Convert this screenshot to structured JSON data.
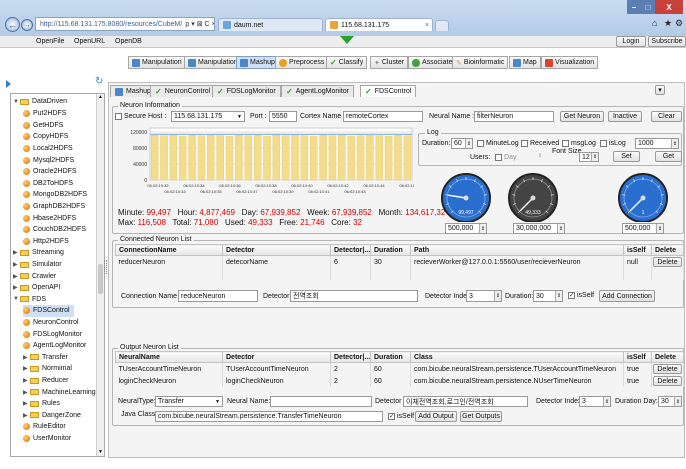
{
  "browser": {
    "address": "http://115.68.131.175:8080/resources/CubeM/",
    "address_controls": "ρ ▾ ⊠ C ×",
    "tabs": [
      {
        "label": "daum.net"
      },
      {
        "label": "115.68.131.175"
      }
    ],
    "window_buttons": [
      "–",
      "□",
      "X"
    ],
    "toolbar_icons": [
      "home-icon",
      "star-icon",
      "gear-icon"
    ]
  },
  "menu": {
    "items": [
      "OpenFile",
      "OpenURL",
      "OpenDB"
    ],
    "login": "Login",
    "subscribe": "Subscribe"
  },
  "modules": [
    {
      "label": "Manipulation",
      "color": "#4a86c8"
    },
    {
      "label": "Manipulation",
      "color": "#4a86c8"
    },
    {
      "label": "Mashup",
      "color": "#4a86c8"
    },
    {
      "label": "Preprocess",
      "color": "#e8a020"
    },
    {
      "label": "Classify",
      "color": "#3fa23f"
    },
    {
      "label": "Cluster",
      "color": "#d2d2d2"
    },
    {
      "label": "Associate",
      "color": "#3fa23f"
    },
    {
      "label": "Bioinformatic",
      "color": "#c8a04a"
    },
    {
      "label": "Map",
      "color": "#4a86c8"
    },
    {
      "label": "Visualization",
      "color": "#d4462f"
    }
  ],
  "tree": {
    "root": "DataDriven",
    "items": [
      {
        "label": "Put2HDFS",
        "kind": "leaf",
        "indent": 1
      },
      {
        "label": "GetHDFS",
        "kind": "leaf",
        "indent": 1
      },
      {
        "label": "CopyHDFS",
        "kind": "leaf",
        "indent": 1
      },
      {
        "label": "Local2HDFS",
        "kind": "leaf",
        "indent": 1
      },
      {
        "label": "Mysql2HDFS",
        "kind": "leaf",
        "indent": 1
      },
      {
        "label": "Oracle2HDFS",
        "kind": "leaf",
        "indent": 1
      },
      {
        "label": "DB2ToHDFS",
        "kind": "leaf",
        "indent": 1
      },
      {
        "label": "MongoDB2HDFS",
        "kind": "leaf",
        "indent": 1
      },
      {
        "label": "GraphDB2HDFS",
        "kind": "leaf",
        "indent": 1
      },
      {
        "label": "Hbase2HDFS",
        "kind": "leaf",
        "indent": 1
      },
      {
        "label": "CouchDB2HDFS",
        "kind": "leaf",
        "indent": 1
      },
      {
        "label": "Http2HDFS",
        "kind": "leaf",
        "indent": 1
      },
      {
        "label": "Streaming",
        "kind": "folder",
        "indent": 0
      },
      {
        "label": "Simulator",
        "kind": "folder",
        "indent": 0
      },
      {
        "label": "Crawler",
        "kind": "folder",
        "indent": 0
      },
      {
        "label": "OpenAPI",
        "kind": "folder",
        "indent": 0
      },
      {
        "label": "FDS",
        "kind": "folder-open",
        "indent": 0
      },
      {
        "label": "FDSControl",
        "kind": "leaf-selected",
        "indent": 1
      },
      {
        "label": "NeuronControl",
        "kind": "leaf",
        "indent": 1
      },
      {
        "label": "FDSLogMonitor",
        "kind": "leaf",
        "indent": 1
      },
      {
        "label": "AgentLogMonitor",
        "kind": "leaf",
        "indent": 1
      },
      {
        "label": "Transfer",
        "kind": "folder",
        "indent": 1
      },
      {
        "label": "Normimal",
        "kind": "folder",
        "indent": 1
      },
      {
        "label": "Reducer",
        "kind": "folder",
        "indent": 1
      },
      {
        "label": "MachineLearning",
        "kind": "folder",
        "indent": 1
      },
      {
        "label": "Rules",
        "kind": "folder",
        "indent": 1
      },
      {
        "label": "DangerZone",
        "kind": "folder",
        "indent": 1
      },
      {
        "label": "RuleEditor",
        "kind": "leaf",
        "indent": 1
      },
      {
        "label": "UserMonitor",
        "kind": "leaf",
        "indent": 1
      }
    ]
  },
  "panel_tabs": [
    {
      "label": "Mashup",
      "selected": false
    },
    {
      "label": "NeuronControl",
      "selected": false
    },
    {
      "label": "FDSLogMonitor",
      "selected": false
    },
    {
      "label": "AgentLogMonitor",
      "selected": false
    },
    {
      "label": "FDSControl",
      "selected": true
    }
  ],
  "neuron_info": {
    "legend": "Neuron Information",
    "secure_label": "Secure",
    "host_label": "Host :",
    "host": "115.68.131.175",
    "port_label": "Port :",
    "port": "5550",
    "cortex_label": "Cortex Name :",
    "cortex": "remoteCortex",
    "neural_label": "Neural Name :",
    "neural": "filterNeuron",
    "get_neuron": "Get Neuron",
    "inactive": "Inactive",
    "clear": "Clear"
  },
  "chart_data": {
    "type": "bar",
    "title": "",
    "y_ticks": [
      "120000",
      "80000",
      "40000",
      "0"
    ],
    "ylim": [
      0,
      130000
    ],
    "x_ticks_top": [
      "06:02:10:32",
      "06:02:10:34",
      "06:02:10:36",
      "06:02:10:38",
      "06:02:10:40",
      "06:02:10:42",
      "06:02:10:44",
      "06:02:10:46"
    ],
    "x_ticks_bottom": [
      "06:02:10:33",
      "06:02:10:35",
      "06:02:10:37",
      "06:02:10:39",
      "06:02:10:41",
      "06:02:10:43"
    ],
    "values": [
      112000,
      111000,
      112000,
      110000,
      112000,
      111000,
      112000,
      111000,
      110000,
      112000,
      111000,
      112000,
      110000,
      112000,
      111000,
      112000,
      111000,
      110000,
      112000,
      111000,
      112000,
      110000,
      111000,
      112000,
      111000,
      110000,
      112000,
      111000
    ]
  },
  "stats": {
    "minute_label": "Minute:",
    "minute": "99,497",
    "hour_label": "Hour:",
    "hour": "4,877,469",
    "day_label": "Day:",
    "day": "67,939,852",
    "week_label": "Week:",
    "week": "67,939,852",
    "month_label": "Month:",
    "month": "134,617,32",
    "max_label": "Max:",
    "max": "116,508",
    "total_label": "Total:",
    "total": "71,080",
    "used_label": "Used:",
    "used": "49,333",
    "free_label": "Free:",
    "free": "21,746",
    "core_label": "Core:",
    "core": "32"
  },
  "log": {
    "legend": "Log",
    "duration_label": "Duration:",
    "duration": "60",
    "minute_log": "MinuteLog",
    "received": "Received",
    "msg_log": "msgLog",
    "is_log": "isLog",
    "is_log_value": "1000",
    "users_label": "Users:",
    "users_value": "Day",
    "font_size_label": "Font Size",
    "font_size": "12",
    "set": "Set",
    "get": "Get"
  },
  "gauges": [
    {
      "name": "gauge-1",
      "readout": "99,497",
      "input": "500,000",
      "level": 0.2,
      "color": "#2a6fd0"
    },
    {
      "name": "gauge-2",
      "readout": "49,333",
      "input": "30,000,000",
      "level": 0.0,
      "color": "#444444"
    },
    {
      "name": "gauge-3",
      "readout": "1",
      "input": "500,000",
      "level": 0.0,
      "color": "#2a6fd0"
    }
  ],
  "connected": {
    "legend": "Connected Neuron List",
    "columns": [
      "ConnectionName",
      "Detector",
      "Detector|...",
      "Duration",
      "Path",
      "isSelf",
      "Delete"
    ],
    "rows": [
      {
        "name": "reducerNeuron",
        "detector": "detecorName",
        "index": "6",
        "duration": "30",
        "path": "recieverWorker@127.0.0.1:5560/user/recieverNeuron",
        "isself": "null",
        "delete": "Delete"
      }
    ],
    "conn_name_label": "Connection Name :",
    "conn_name": "reduceNeuron",
    "detector_label": "Detector :",
    "detector": "전역조회",
    "index_label": "Detector Index:",
    "index": "3",
    "duration_label": "Duration:",
    "duration": "30",
    "isself_label": "isSelf",
    "add": "Add Connection"
  },
  "output": {
    "legend": "Output Neuron List",
    "columns": [
      "NeuralName",
      "Detector",
      "Detector|...",
      "Duration",
      "Class",
      "isSelf",
      "Delete"
    ],
    "rows": [
      {
        "name": "TUserAccountTimeNeuron",
        "detector": "TUserAccountTimeNeuron",
        "index": "2",
        "duration": "60",
        "class": "com.bicube.neuralStream.persistence.TUserAccountTimeNeuron",
        "isself": "true",
        "delete": "Delete"
      },
      {
        "name": "loginCheckNeuron",
        "detector": "loginCheckNeuron",
        "index": "2",
        "duration": "60",
        "class": "com.bicube.neuralStream.persistence.NUserTimeNeuron",
        "isself": "true",
        "delete": "Delete"
      }
    ],
    "type_label": "NeuralType:",
    "type": "Transfer",
    "neural_label": "Neural Name:",
    "neural": "",
    "detector_label": "Detector :",
    "detector": "이체전역조회,로그인/전역조회",
    "index_label": "Detector Index:",
    "index": "3",
    "duration_label": "Duration Day:",
    "duration": "30",
    "class_label": "Java Class",
    "class": "com.bicube.neuralStream.persistence.TransferTimeNeuron",
    "isself_label": "isSelf",
    "add": "Add Output",
    "get": "Get Outputs"
  }
}
